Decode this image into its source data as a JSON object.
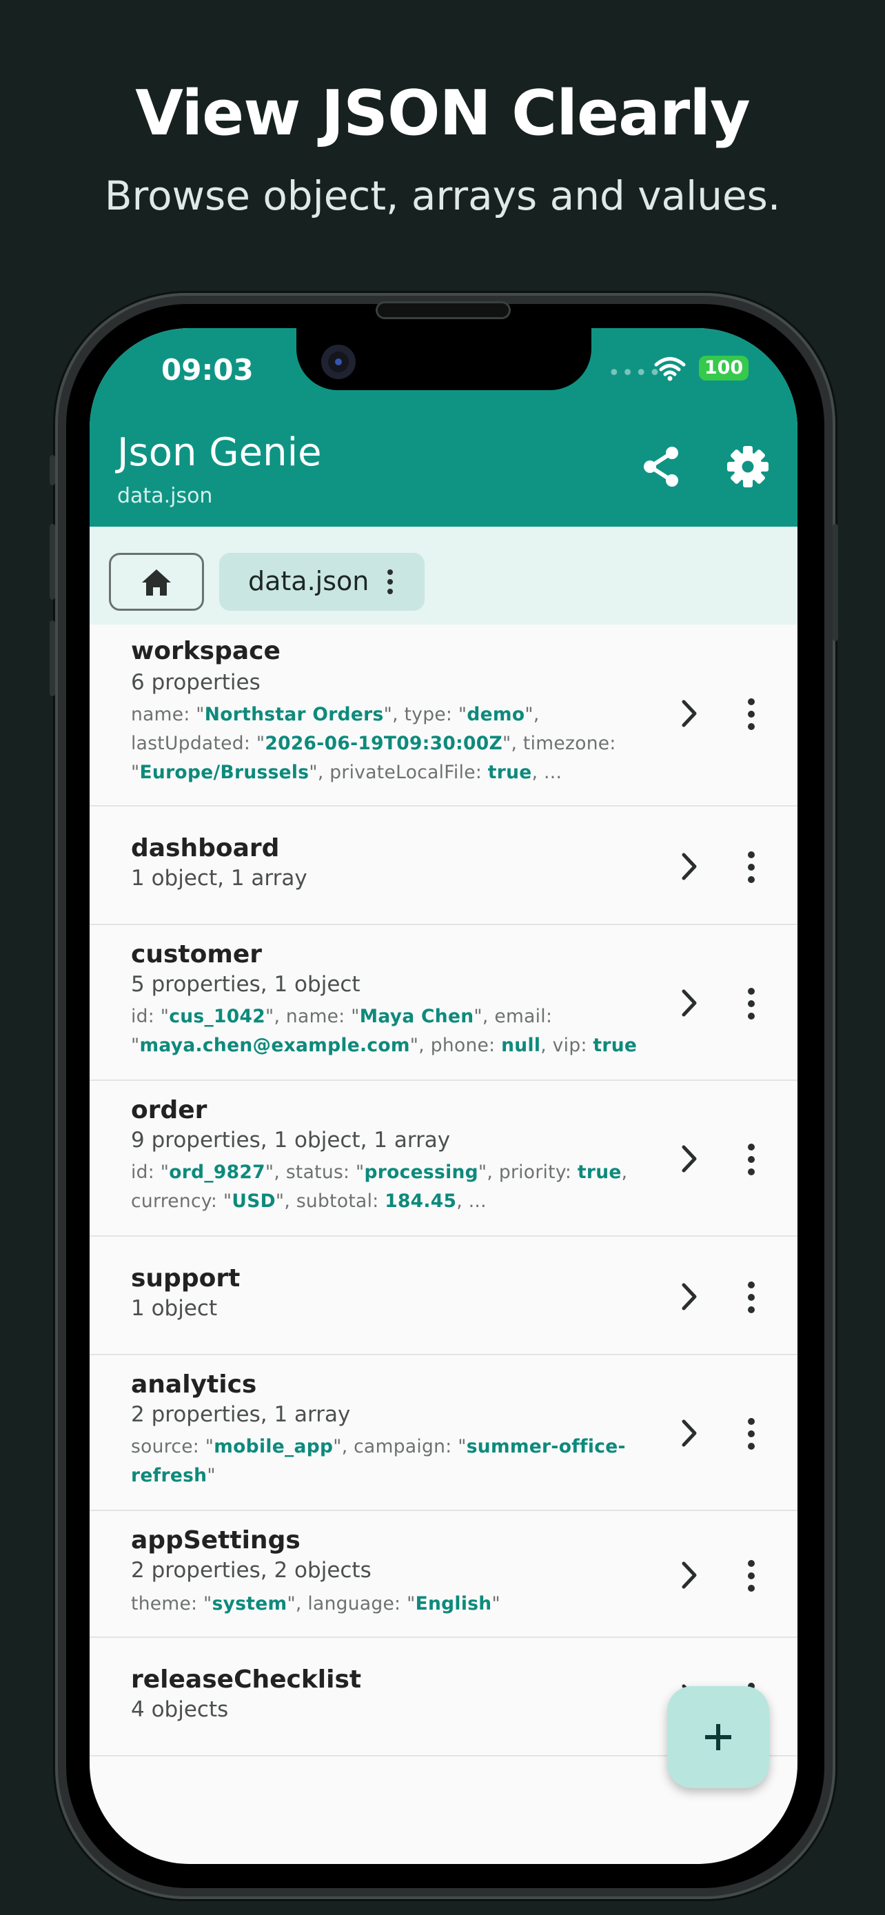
{
  "hero": {
    "title": "View JSON Clearly",
    "subtitle": "Browse object, arrays and values."
  },
  "status_bar": {
    "time": "09:03",
    "battery": "100"
  },
  "app_bar": {
    "title": "Json Genie",
    "subtitle": "data.json",
    "icons": [
      "share-icon",
      "settings-icon"
    ]
  },
  "breadcrumb": {
    "home_icon": "home-icon",
    "file": "data.json"
  },
  "colors": {
    "accent": "#0f9484",
    "value": "#0d8a7c",
    "fab": "#b8e6df"
  },
  "items": [
    {
      "key": "workspace",
      "summary": "6 properties",
      "preview_lines": [
        [
          [
            "k",
            "name: \""
          ],
          [
            "v",
            "Northstar Orders"
          ],
          [
            "k",
            "\", type: \""
          ],
          [
            "v",
            "demo"
          ],
          [
            "k",
            "\","
          ]
        ],
        [
          [
            "k",
            "lastUpdated: \""
          ],
          [
            "v",
            "2026-06-19T09:30:00Z"
          ],
          [
            "k",
            "\", timezone:"
          ]
        ],
        [
          [
            "k",
            "\""
          ],
          [
            "v",
            "Europe/Brussels"
          ],
          [
            "k",
            "\", privateLocalFile: "
          ],
          [
            "v",
            "true"
          ],
          [
            "k",
            ", ..."
          ]
        ]
      ]
    },
    {
      "key": "dashboard",
      "summary": "1 object, 1 array",
      "preview_lines": []
    },
    {
      "key": "customer",
      "summary": "5 properties, 1 object",
      "preview_lines": [
        [
          [
            "k",
            "id: \""
          ],
          [
            "v",
            "cus_1042"
          ],
          [
            "k",
            "\", name: \""
          ],
          [
            "v",
            "Maya Chen"
          ],
          [
            "k",
            "\", email:"
          ]
        ],
        [
          [
            "k",
            "\""
          ],
          [
            "v",
            "maya.chen@example.com"
          ],
          [
            "k",
            "\", phone: "
          ],
          [
            "v",
            "null"
          ],
          [
            "k",
            ", vip: "
          ],
          [
            "v",
            "true"
          ]
        ]
      ]
    },
    {
      "key": "order",
      "summary": "9 properties, 1 object, 1 array",
      "preview_lines": [
        [
          [
            "k",
            "id: \""
          ],
          [
            "v",
            "ord_9827"
          ],
          [
            "k",
            "\", status: \""
          ],
          [
            "v",
            "processing"
          ],
          [
            "k",
            "\", priority: "
          ],
          [
            "v",
            "true"
          ],
          [
            "k",
            ","
          ]
        ],
        [
          [
            "k",
            "currency: \""
          ],
          [
            "v",
            "USD"
          ],
          [
            "k",
            "\", subtotal: "
          ],
          [
            "v",
            "184.45"
          ],
          [
            "k",
            ", ..."
          ]
        ]
      ]
    },
    {
      "key": "support",
      "summary": "1 object",
      "preview_lines": []
    },
    {
      "key": "analytics",
      "summary": "2 properties, 1 array",
      "preview_lines": [
        [
          [
            "k",
            "source: \""
          ],
          [
            "v",
            "mobile_app"
          ],
          [
            "k",
            "\", campaign: \""
          ],
          [
            "v",
            "summer-office-"
          ]
        ],
        [
          [
            "v",
            "refresh"
          ],
          [
            "k",
            "\""
          ]
        ]
      ]
    },
    {
      "key": "appSettings",
      "summary": "2 properties, 2 objects",
      "preview_lines": [
        [
          [
            "k",
            "theme: \""
          ],
          [
            "v",
            "system"
          ],
          [
            "k",
            "\", language: \""
          ],
          [
            "v",
            "English"
          ],
          [
            "k",
            "\""
          ]
        ]
      ]
    },
    {
      "key": "releaseChecklist",
      "summary": "4 objects",
      "preview_lines": []
    }
  ],
  "fab_icon": "plus-icon"
}
